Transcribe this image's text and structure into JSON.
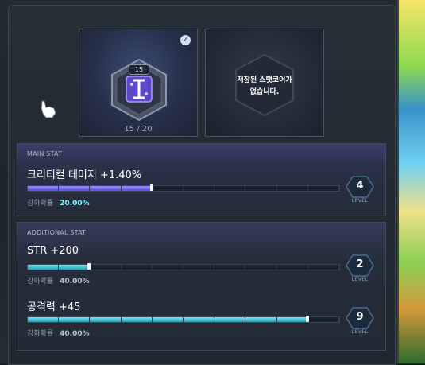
{
  "core": {
    "selected_level_badge": "15",
    "count": "15 / 20",
    "icon": "purple-bolt-core-icon",
    "checked_icon": "checkmark-icon"
  },
  "empty_slot": {
    "line1": "저장된 스탯코어가",
    "line2": "없습니다."
  },
  "main_stat": {
    "section_label": "MAIN STAT",
    "name": "크리티컬 데미지 +1.40%",
    "probability_label": "강화확률",
    "probability_value": "20.00%",
    "level": "4",
    "level_label": "LEVEL",
    "progress": 0.4
  },
  "additional_stat": {
    "section_label": "ADDITIONAL STAT",
    "stats": [
      {
        "name": "STR +200",
        "probability_label": "강화확률",
        "probability_value": "40.00%",
        "level": "2",
        "level_label": "LEVEL",
        "progress": 0.2
      },
      {
        "name": "공격력 +45",
        "probability_label": "강화확률",
        "probability_value": "40.00%",
        "level": "9",
        "level_label": "LEVEL",
        "progress": 0.9
      }
    ]
  },
  "colors": {
    "main_bar": "#6b5ce0",
    "additional_bar": "#38b6cc",
    "probability_highlight": "#7ef2ff"
  }
}
